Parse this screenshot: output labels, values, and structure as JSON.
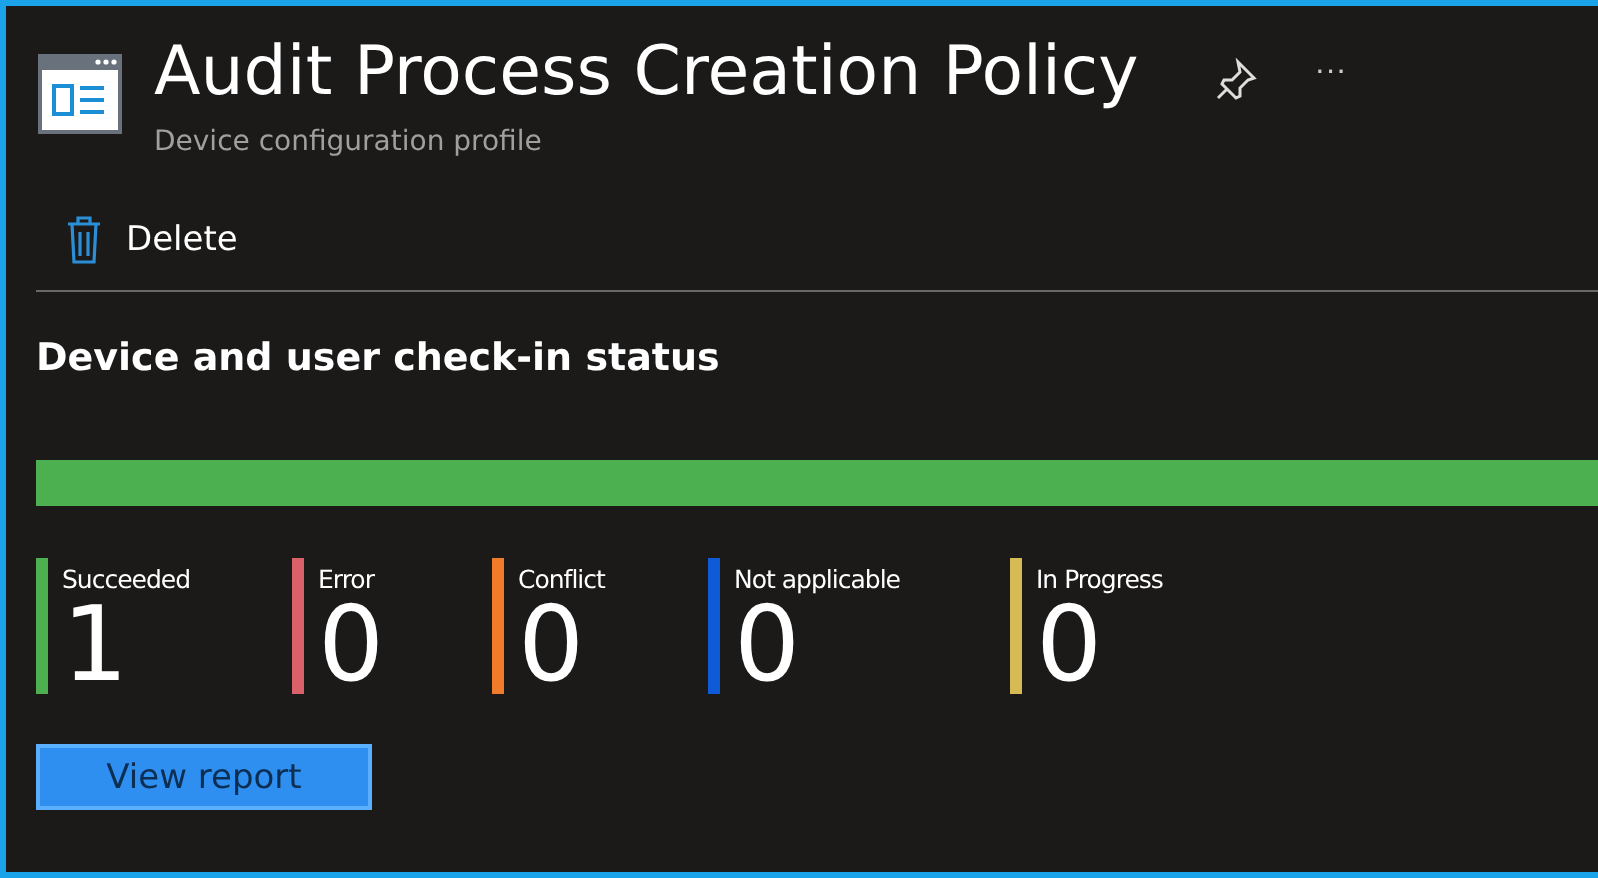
{
  "header": {
    "title": "Audit Process Creation Policy",
    "subtitle": "Device configuration profile",
    "more": "···"
  },
  "toolbar": [
    {
      "label": "Delete"
    }
  ],
  "section": {
    "title": "Device and user check-in status",
    "progress": {
      "level": 1
    },
    "statuses": [
      {
        "label": "Succeeded",
        "count": "1",
        "color": "#4caf50"
      },
      {
        "label": "Error",
        "count": "0",
        "color": "#d9626a"
      },
      {
        "label": "Conflict",
        "count": "0",
        "color": "#ef7b2b"
      },
      {
        "label": "Not applicable",
        "count": "0",
        "color": "#0f5bd7"
      },
      {
        "label": "In Progress",
        "count": "0",
        "color": "#d6bb55"
      }
    ],
    "button": "View report"
  }
}
